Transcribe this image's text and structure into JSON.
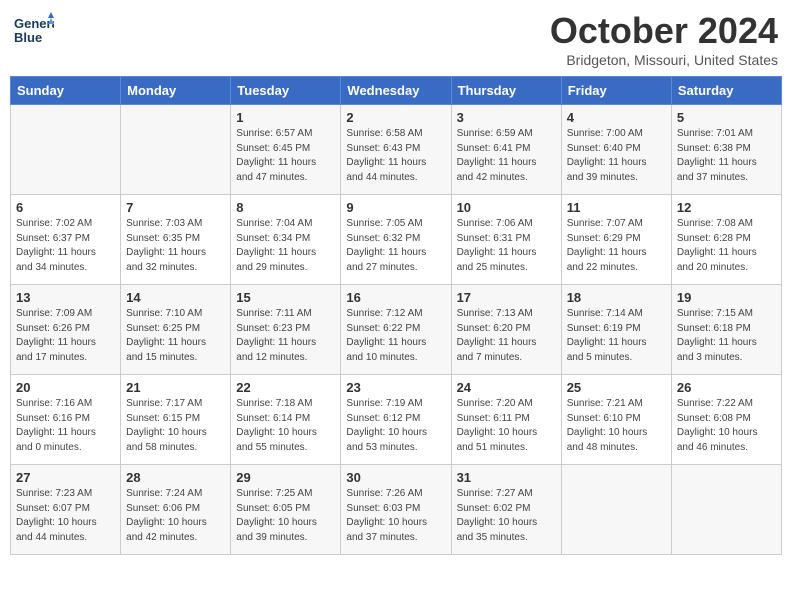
{
  "header": {
    "logo_line1": "General",
    "logo_line2": "Blue",
    "month": "October 2024",
    "location": "Bridgeton, Missouri, United States"
  },
  "weekdays": [
    "Sunday",
    "Monday",
    "Tuesday",
    "Wednesday",
    "Thursday",
    "Friday",
    "Saturday"
  ],
  "weeks": [
    [
      {
        "day": "",
        "sunrise": "",
        "sunset": "",
        "daylight": ""
      },
      {
        "day": "",
        "sunrise": "",
        "sunset": "",
        "daylight": ""
      },
      {
        "day": "1",
        "sunrise": "Sunrise: 6:57 AM",
        "sunset": "Sunset: 6:45 PM",
        "daylight": "Daylight: 11 hours and 47 minutes."
      },
      {
        "day": "2",
        "sunrise": "Sunrise: 6:58 AM",
        "sunset": "Sunset: 6:43 PM",
        "daylight": "Daylight: 11 hours and 44 minutes."
      },
      {
        "day": "3",
        "sunrise": "Sunrise: 6:59 AM",
        "sunset": "Sunset: 6:41 PM",
        "daylight": "Daylight: 11 hours and 42 minutes."
      },
      {
        "day": "4",
        "sunrise": "Sunrise: 7:00 AM",
        "sunset": "Sunset: 6:40 PM",
        "daylight": "Daylight: 11 hours and 39 minutes."
      },
      {
        "day": "5",
        "sunrise": "Sunrise: 7:01 AM",
        "sunset": "Sunset: 6:38 PM",
        "daylight": "Daylight: 11 hours and 37 minutes."
      }
    ],
    [
      {
        "day": "6",
        "sunrise": "Sunrise: 7:02 AM",
        "sunset": "Sunset: 6:37 PM",
        "daylight": "Daylight: 11 hours and 34 minutes."
      },
      {
        "day": "7",
        "sunrise": "Sunrise: 7:03 AM",
        "sunset": "Sunset: 6:35 PM",
        "daylight": "Daylight: 11 hours and 32 minutes."
      },
      {
        "day": "8",
        "sunrise": "Sunrise: 7:04 AM",
        "sunset": "Sunset: 6:34 PM",
        "daylight": "Daylight: 11 hours and 29 minutes."
      },
      {
        "day": "9",
        "sunrise": "Sunrise: 7:05 AM",
        "sunset": "Sunset: 6:32 PM",
        "daylight": "Daylight: 11 hours and 27 minutes."
      },
      {
        "day": "10",
        "sunrise": "Sunrise: 7:06 AM",
        "sunset": "Sunset: 6:31 PM",
        "daylight": "Daylight: 11 hours and 25 minutes."
      },
      {
        "day": "11",
        "sunrise": "Sunrise: 7:07 AM",
        "sunset": "Sunset: 6:29 PM",
        "daylight": "Daylight: 11 hours and 22 minutes."
      },
      {
        "day": "12",
        "sunrise": "Sunrise: 7:08 AM",
        "sunset": "Sunset: 6:28 PM",
        "daylight": "Daylight: 11 hours and 20 minutes."
      }
    ],
    [
      {
        "day": "13",
        "sunrise": "Sunrise: 7:09 AM",
        "sunset": "Sunset: 6:26 PM",
        "daylight": "Daylight: 11 hours and 17 minutes."
      },
      {
        "day": "14",
        "sunrise": "Sunrise: 7:10 AM",
        "sunset": "Sunset: 6:25 PM",
        "daylight": "Daylight: 11 hours and 15 minutes."
      },
      {
        "day": "15",
        "sunrise": "Sunrise: 7:11 AM",
        "sunset": "Sunset: 6:23 PM",
        "daylight": "Daylight: 11 hours and 12 minutes."
      },
      {
        "day": "16",
        "sunrise": "Sunrise: 7:12 AM",
        "sunset": "Sunset: 6:22 PM",
        "daylight": "Daylight: 11 hours and 10 minutes."
      },
      {
        "day": "17",
        "sunrise": "Sunrise: 7:13 AM",
        "sunset": "Sunset: 6:20 PM",
        "daylight": "Daylight: 11 hours and 7 minutes."
      },
      {
        "day": "18",
        "sunrise": "Sunrise: 7:14 AM",
        "sunset": "Sunset: 6:19 PM",
        "daylight": "Daylight: 11 hours and 5 minutes."
      },
      {
        "day": "19",
        "sunrise": "Sunrise: 7:15 AM",
        "sunset": "Sunset: 6:18 PM",
        "daylight": "Daylight: 11 hours and 3 minutes."
      }
    ],
    [
      {
        "day": "20",
        "sunrise": "Sunrise: 7:16 AM",
        "sunset": "Sunset: 6:16 PM",
        "daylight": "Daylight: 11 hours and 0 minutes."
      },
      {
        "day": "21",
        "sunrise": "Sunrise: 7:17 AM",
        "sunset": "Sunset: 6:15 PM",
        "daylight": "Daylight: 10 hours and 58 minutes."
      },
      {
        "day": "22",
        "sunrise": "Sunrise: 7:18 AM",
        "sunset": "Sunset: 6:14 PM",
        "daylight": "Daylight: 10 hours and 55 minutes."
      },
      {
        "day": "23",
        "sunrise": "Sunrise: 7:19 AM",
        "sunset": "Sunset: 6:12 PM",
        "daylight": "Daylight: 10 hours and 53 minutes."
      },
      {
        "day": "24",
        "sunrise": "Sunrise: 7:20 AM",
        "sunset": "Sunset: 6:11 PM",
        "daylight": "Daylight: 10 hours and 51 minutes."
      },
      {
        "day": "25",
        "sunrise": "Sunrise: 7:21 AM",
        "sunset": "Sunset: 6:10 PM",
        "daylight": "Daylight: 10 hours and 48 minutes."
      },
      {
        "day": "26",
        "sunrise": "Sunrise: 7:22 AM",
        "sunset": "Sunset: 6:08 PM",
        "daylight": "Daylight: 10 hours and 46 minutes."
      }
    ],
    [
      {
        "day": "27",
        "sunrise": "Sunrise: 7:23 AM",
        "sunset": "Sunset: 6:07 PM",
        "daylight": "Daylight: 10 hours and 44 minutes."
      },
      {
        "day": "28",
        "sunrise": "Sunrise: 7:24 AM",
        "sunset": "Sunset: 6:06 PM",
        "daylight": "Daylight: 10 hours and 42 minutes."
      },
      {
        "day": "29",
        "sunrise": "Sunrise: 7:25 AM",
        "sunset": "Sunset: 6:05 PM",
        "daylight": "Daylight: 10 hours and 39 minutes."
      },
      {
        "day": "30",
        "sunrise": "Sunrise: 7:26 AM",
        "sunset": "Sunset: 6:03 PM",
        "daylight": "Daylight: 10 hours and 37 minutes."
      },
      {
        "day": "31",
        "sunrise": "Sunrise: 7:27 AM",
        "sunset": "Sunset: 6:02 PM",
        "daylight": "Daylight: 10 hours and 35 minutes."
      },
      {
        "day": "",
        "sunrise": "",
        "sunset": "",
        "daylight": ""
      },
      {
        "day": "",
        "sunrise": "",
        "sunset": "",
        "daylight": ""
      }
    ]
  ]
}
